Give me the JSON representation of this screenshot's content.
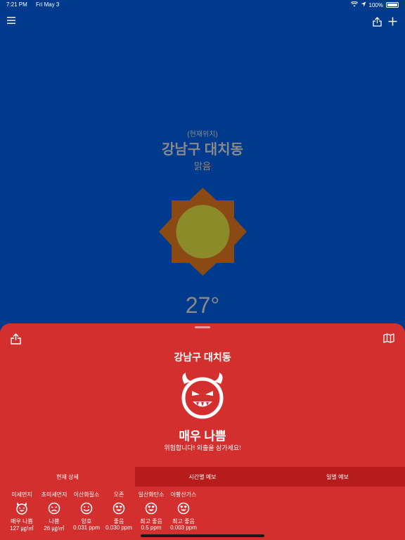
{
  "status_bar": {
    "time": "7:21 PM",
    "date": "Fri May 3",
    "battery": "100%"
  },
  "weather": {
    "location_sub": "(현재위치)",
    "location": "강남구 대치동",
    "condition": "맑음",
    "temperature": "27°"
  },
  "sheet": {
    "title": "강남구 대치동",
    "grade": "매우 나쁨",
    "advice": "위험합니다! 외출을 삼가세요!",
    "tabs": [
      {
        "label": "현재 상세"
      },
      {
        "label": "시간별 예보"
      },
      {
        "label": "일별 예보"
      }
    ],
    "pollutants": [
      {
        "name": "미세먼지",
        "status": "매우 나쁨",
        "value": "127 ㎍/㎥",
        "face": "devil"
      },
      {
        "name": "초미세먼지",
        "status": "나쁨",
        "value": "26 ㎍/㎥",
        "face": "sad"
      },
      {
        "name": "이산화질소",
        "status": "양호",
        "value": "0.031 ppm",
        "face": "smile"
      },
      {
        "name": "오존",
        "status": "좋음",
        "value": "0.030 ppm",
        "face": "love"
      },
      {
        "name": "일산화탄소",
        "status": "최고 좋음",
        "value": "0.5 ppm",
        "face": "love"
      },
      {
        "name": "아황산가스",
        "status": "최고 좋음",
        "value": "0.003 ppm",
        "face": "love"
      }
    ]
  },
  "colors": {
    "background": "#003a8c",
    "sheet": "#d32f2f",
    "tab_inactive": "#b71c1c",
    "sun_core": "#8b8b2a",
    "sun_rays": "#8b4a14"
  }
}
